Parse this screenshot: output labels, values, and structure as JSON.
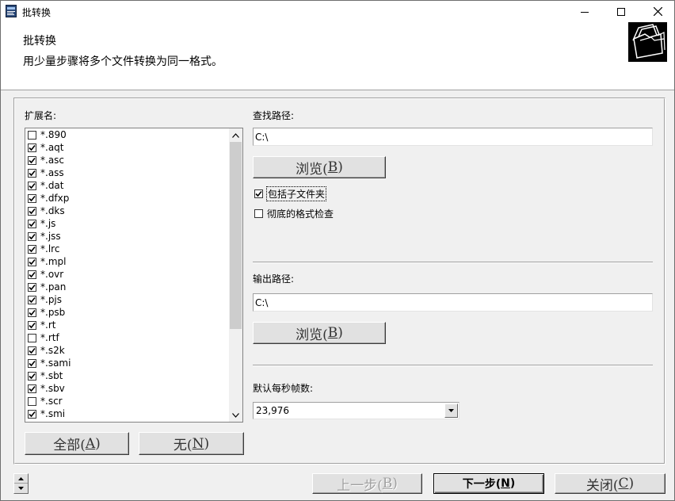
{
  "window": {
    "title": "批转换"
  },
  "header": {
    "title": "批转换",
    "subtitle": "用少量步骤将多个文件转换为同一格式。"
  },
  "left": {
    "extensions_label": "扩展名:",
    "items": [
      {
        "label": "*.890",
        "checked": false
      },
      {
        "label": "*.aqt",
        "checked": true
      },
      {
        "label": "*.asc",
        "checked": true
      },
      {
        "label": "*.ass",
        "checked": true
      },
      {
        "label": "*.dat",
        "checked": true
      },
      {
        "label": "*.dfxp",
        "checked": true
      },
      {
        "label": "*.dks",
        "checked": true
      },
      {
        "label": "*.js",
        "checked": true
      },
      {
        "label": "*.jss",
        "checked": true
      },
      {
        "label": "*.lrc",
        "checked": true
      },
      {
        "label": "*.mpl",
        "checked": true
      },
      {
        "label": "*.ovr",
        "checked": true
      },
      {
        "label": "*.pan",
        "checked": true
      },
      {
        "label": "*.pjs",
        "checked": true
      },
      {
        "label": "*.psb",
        "checked": true
      },
      {
        "label": "*.rt",
        "checked": true
      },
      {
        "label": "*.rtf",
        "checked": false
      },
      {
        "label": "*.s2k",
        "checked": true
      },
      {
        "label": "*.sami",
        "checked": true
      },
      {
        "label": "*.sbt",
        "checked": true
      },
      {
        "label": "*.sbv",
        "checked": true
      },
      {
        "label": "*.scr",
        "checked": false
      },
      {
        "label": "*.smi",
        "checked": true
      }
    ],
    "all_button": {
      "text": "全部(",
      "key": "A",
      "end": ")"
    },
    "none_button": {
      "text": "无(",
      "key": "N",
      "end": ")"
    }
  },
  "search": {
    "label": "查找路径:",
    "path": "C:\\",
    "browse": {
      "text": "浏览(",
      "key": "B",
      "end": ")"
    },
    "include_subfolders": {
      "label": "包括子文件夹",
      "checked": true
    },
    "thorough_check": {
      "label": "彻底的格式检查",
      "checked": false
    }
  },
  "output": {
    "label": "输出路径:",
    "path": "C:\\",
    "browse": {
      "text": "浏览(",
      "key": "B",
      "end": ")"
    }
  },
  "fps": {
    "label": "默认每秒帧数:",
    "value": "23,976"
  },
  "footer": {
    "back": {
      "text": "上一步(",
      "key": "B",
      "end": ")"
    },
    "next": {
      "text": "下一步(",
      "key": "N",
      "end": ")"
    },
    "close": {
      "text": "关闭(",
      "key": "C",
      "end": ")"
    }
  }
}
